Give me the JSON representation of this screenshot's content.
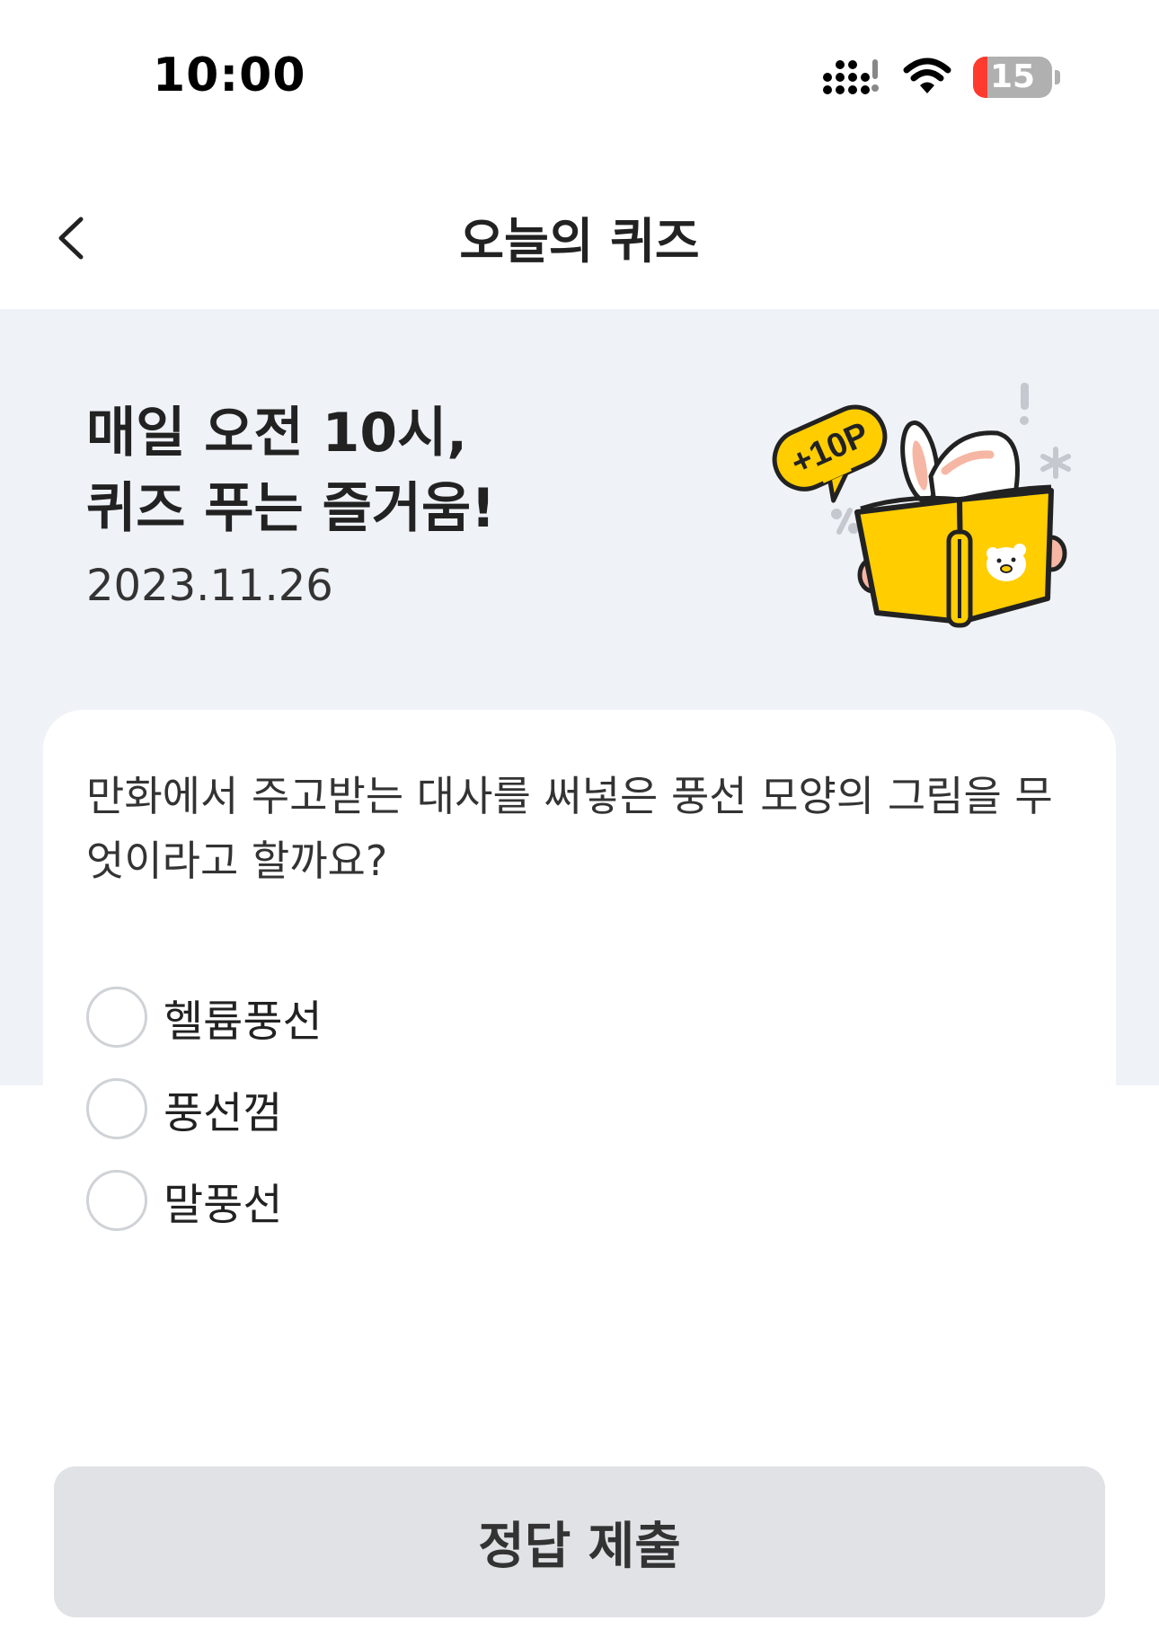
{
  "status_bar": {
    "time": "10:00",
    "battery_level": "15"
  },
  "nav": {
    "title": "오늘의 퀴즈"
  },
  "hero": {
    "headline_line1": "매일 오전 10시,",
    "headline_line2": "퀴즈 푸는 즐거움!",
    "date": "2023.11.26",
    "badge": "+10P"
  },
  "quiz": {
    "question": "만화에서 주고받는 대사를 써넣은 풍선 모양의 그림을 무엇이라고 할까요?",
    "options": [
      {
        "label": "헬륨풍선",
        "selected": false
      },
      {
        "label": "풍선껌",
        "selected": false
      },
      {
        "label": "말풍선",
        "selected": false
      }
    ]
  },
  "submit": {
    "label": "정답 제출"
  },
  "colors": {
    "accent_yellow": "#ffcd00",
    "hero_bg": "#eff2f7",
    "button_bg": "#e0e2e5",
    "battery_low": "#ff3b30"
  }
}
